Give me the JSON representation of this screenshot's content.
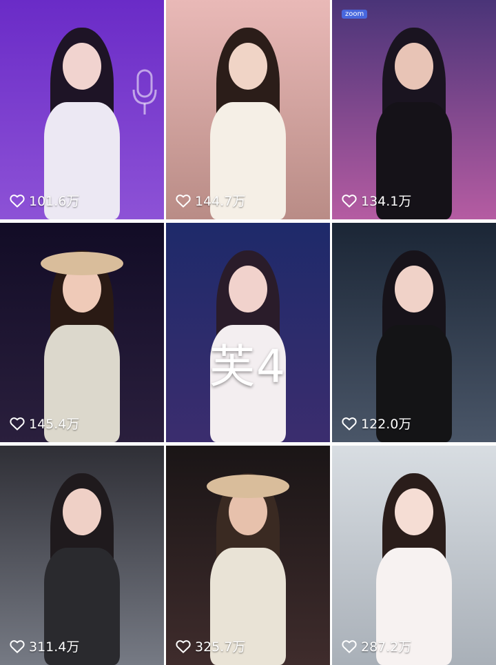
{
  "grid": {
    "tiles": [
      {
        "likes": "101.6万",
        "colors": {
          "bg_top": "#6a2bc7",
          "bg_bottom": "#8d52d6",
          "hair": "#1e1426",
          "skin": "#f1d3cf",
          "outfit": "#ece8f3"
        },
        "decor": "mic-outline"
      },
      {
        "likes": "144.7万",
        "colors": {
          "bg_top": "#e9b9b7",
          "bg_bottom": "#b98c86",
          "hair": "#2b1d19",
          "skin": "#f0d4c6",
          "outfit": "#f5efe6"
        }
      },
      {
        "likes": "134.1万",
        "colors": {
          "bg_top": "#4a3478",
          "bg_bottom": "#b55ca2",
          "hair": "#1a1420",
          "skin": "#e8c4b6",
          "outfit": "#151218"
        },
        "badge": "zoom"
      },
      {
        "likes": "145.4万",
        "colors": {
          "bg_top": "#120c26",
          "bg_bottom": "#2a1f3d",
          "hair": "#2a1a14",
          "skin": "#efcab8",
          "outfit": "#dcd8cc"
        },
        "decor": "hat"
      },
      {
        "likes": "",
        "overlay": "芙4",
        "colors": {
          "bg_top": "#1e2a6a",
          "bg_bottom": "#3b2d6e",
          "hair": "#2a1c2a",
          "skin": "#f1d2cc",
          "outfit": "#f3eef0"
        }
      },
      {
        "likes": "122.0万",
        "colors": {
          "bg_top": "#1b2636",
          "bg_bottom": "#4a5668",
          "hair": "#17131a",
          "skin": "#f0d2c8",
          "outfit": "#141416"
        }
      },
      {
        "likes": "311.4万",
        "colors": {
          "bg_top": "#2f2f36",
          "bg_bottom": "#767a84",
          "hair": "#1f1a1d",
          "skin": "#efd0c6",
          "outfit": "#2a2a2e"
        }
      },
      {
        "likes": "325.7万",
        "colors": {
          "bg_top": "#1a1516",
          "bg_bottom": "#3f2c2c",
          "hair": "#3a2a22",
          "skin": "#e7c1ac",
          "outfit": "#e9e3d6"
        },
        "decor": "hat"
      },
      {
        "likes": "287.2万",
        "colors": {
          "bg_top": "#d8dde2",
          "bg_bottom": "#a9b0b8",
          "hair": "#2a1d1a",
          "skin": "#f5ddd4",
          "outfit": "#f7f2f1"
        }
      }
    ]
  }
}
